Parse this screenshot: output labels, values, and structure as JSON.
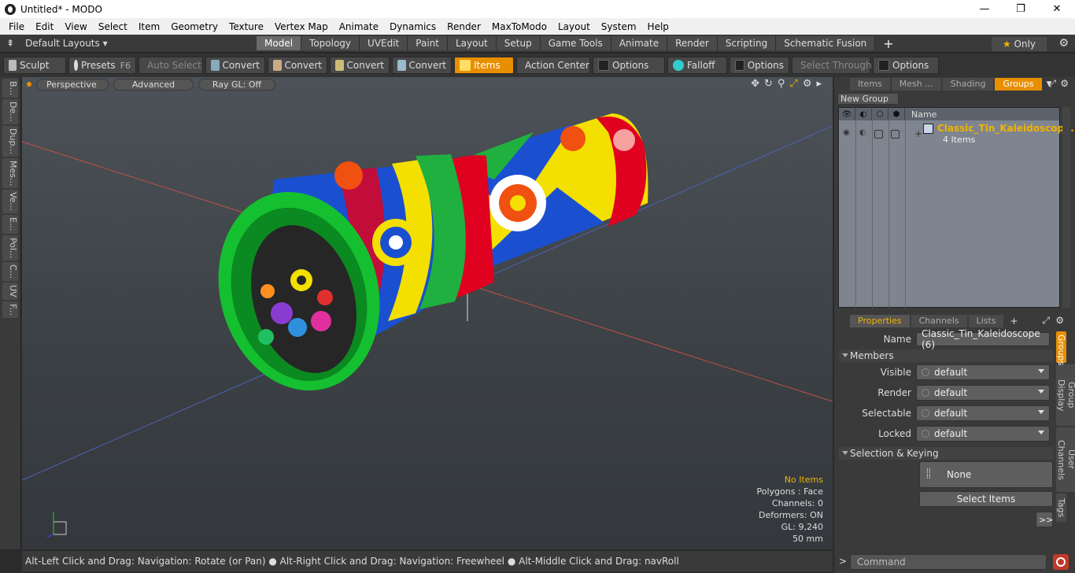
{
  "window": {
    "title": "Untitled* - MODO",
    "min": "—",
    "max": "❐",
    "close": "✕"
  },
  "menu": [
    "File",
    "Edit",
    "View",
    "Select",
    "Item",
    "Geometry",
    "Texture",
    "Vertex Map",
    "Animate",
    "Dynamics",
    "Render",
    "MaxToModo",
    "Layout",
    "System",
    "Help"
  ],
  "layouts": {
    "default": "Default Layouts ▾",
    "tabs": [
      "Model",
      "Topology",
      "UVEdit",
      "Paint",
      "Layout",
      "Setup",
      "Game Tools",
      "Animate",
      "Render",
      "Scripting",
      "Schematic Fusion"
    ],
    "active": "Model",
    "only": "Only"
  },
  "toolbar": {
    "sculpt": "Sculpt",
    "presets": "Presets",
    "presets_key": "F6",
    "auto_select": "Auto Select",
    "convert": "Convert",
    "items": "Items",
    "action_center": "Action Center",
    "options": "Options",
    "falloff": "Falloff",
    "select_through": "Select Through"
  },
  "lefttabs": [
    "B...",
    "De...",
    "Dup...",
    "Mes...",
    "Ve...",
    "E...",
    "Pol...",
    "C...",
    "UV",
    "F..."
  ],
  "viewport": {
    "perspective": "Perspective",
    "advanced": "Advanced",
    "raygl": "Ray GL: Off",
    "info": {
      "items": "No Items",
      "polygons": "Polygons : Face",
      "channels": "Channels: 0",
      "deformers": "Deformers: ON",
      "gl": "GL: 9,240",
      "scale": "50 mm"
    }
  },
  "status": "Alt-Left Click and Drag: Navigation: Rotate (or Pan) ● Alt-Right Click and Drag: Navigation: Freewheel ● Alt-Middle Click and Drag: navRoll",
  "groups_panel": {
    "tabs": [
      "Items",
      "Mesh ...",
      "Shading",
      "Groups"
    ],
    "new_group": "New Group",
    "name_header": "Name",
    "group_name": "Classic_Tin_Kaleidoscope...",
    "group_count": "4 Items"
  },
  "props_panel": {
    "tabs": [
      "Properties",
      "Channels",
      "Lists"
    ],
    "name_label": "Name",
    "name_value": "Classic_Tin_Kaleidoscope (6)",
    "members": "Members",
    "visible_label": "Visible",
    "render_label": "Render",
    "selectable_label": "Selectable",
    "locked_label": "Locked",
    "default": "default",
    "selection": "Selection & Keying",
    "none": "None",
    "select_items": "Select Items",
    "more": ">>",
    "side_tabs": [
      "Groups",
      "Group Display",
      "User Channels",
      "Tags"
    ]
  },
  "command_placeholder": "Command"
}
